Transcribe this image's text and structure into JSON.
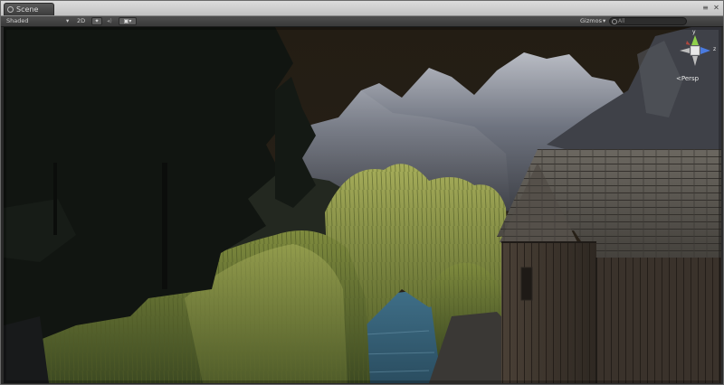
{
  "window": {
    "tab_label": "Scene"
  },
  "toolbar": {
    "shading_mode": "Shaded",
    "mode_2d": "2D",
    "gizmos_label": "Gizmos",
    "search_placeholder": "All"
  },
  "scene_view": {
    "projection_label": "Persp",
    "gizmo_axes": {
      "y": "y",
      "z": "z"
    }
  },
  "colors": {
    "y_axis": "#8fd14a",
    "z_axis": "#4a7be0",
    "x_axis": "#e04a3b"
  }
}
